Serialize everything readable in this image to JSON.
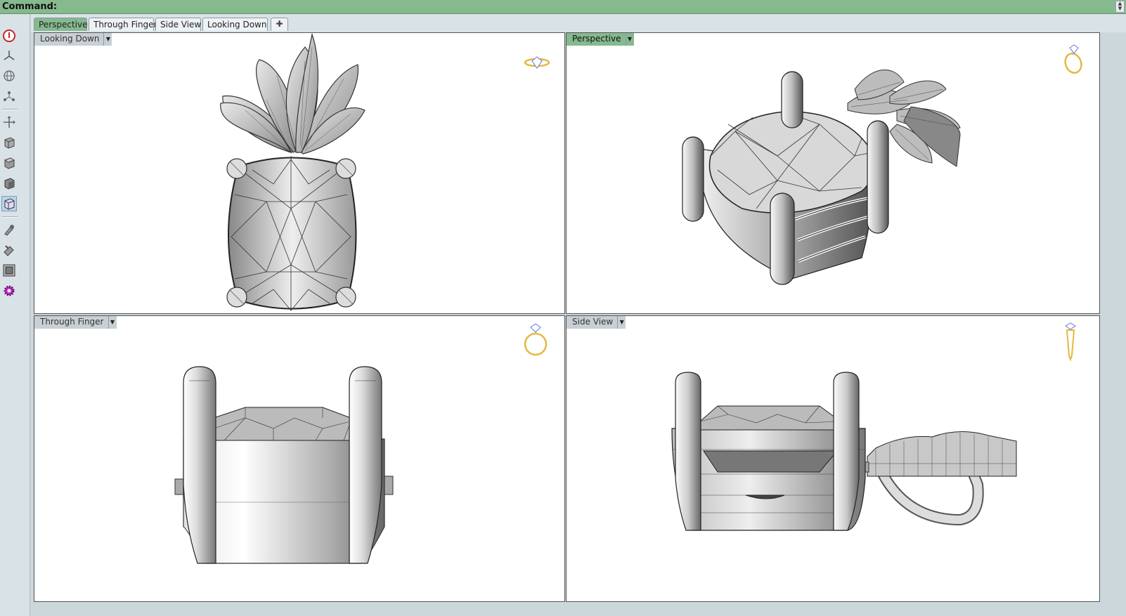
{
  "command_bar": {
    "label": "Command:",
    "scroll_icon": "scroll-arrows-icon"
  },
  "toolbar": {
    "buttons": [
      "cancel-icon",
      "planar-icon",
      "globe-icon",
      "osnap-icon",
      "gumball-icon",
      "wireframe-icon",
      "shaded-icon",
      "rendered-icon",
      "ghosted-icon",
      "paint-brush-icon",
      "properties-icon",
      "viewport-icon",
      "gear-icon"
    ],
    "active_index": 8
  },
  "tabs": {
    "items": [
      "Perspective",
      "Through Finger",
      "Side View",
      "Looking Down"
    ],
    "active": "Perspective",
    "add_icon": "plus-icon"
  },
  "viewports": {
    "top_left": {
      "label": "Looking Down",
      "nav_icon": "ring-top-icon",
      "active": false
    },
    "top_right": {
      "label": "Perspective",
      "nav_icon": "ring-perspective-icon",
      "active": true
    },
    "bottom_left": {
      "label": "Through Finger",
      "nav_icon": "ring-front-icon",
      "active": false
    },
    "bottom_right": {
      "label": "Side View",
      "nav_icon": "ring-side-icon",
      "active": false
    }
  },
  "colors": {
    "accent": "#86b98e",
    "gold": "#e6b840",
    "diamond": "#5b7bd8"
  }
}
